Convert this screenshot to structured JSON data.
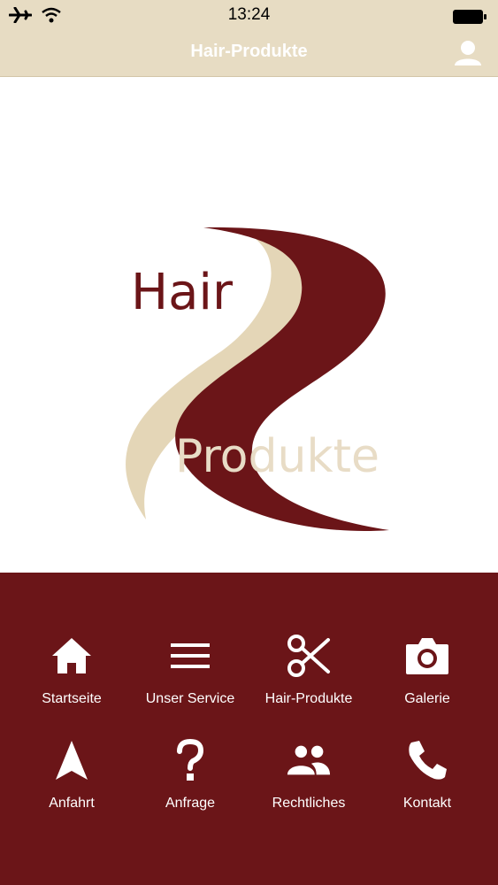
{
  "status_bar": {
    "time": "13:24",
    "icons": [
      "airplane-icon",
      "wifi-icon",
      "battery-icon"
    ]
  },
  "nav_bar": {
    "title": "Hair-Produkte",
    "right_icon": "user-icon"
  },
  "logo": {
    "word_top": "Hair",
    "word_bottom": "Produkte",
    "colors": {
      "wave_dark": "#6b1518",
      "wave_light": "#e4d6b7",
      "text": "#6b1518",
      "text_on_dark": "#e8dcc6"
    }
  },
  "colors": {
    "bar_bg": "#e7dcc3",
    "menu_bg": "#6b1518",
    "menu_text": "#ffffff"
  },
  "menu": {
    "items": [
      {
        "label": "Startseite",
        "icon": "home-icon"
      },
      {
        "label": "Unser Service",
        "icon": "menu-lines-icon"
      },
      {
        "label": "Hair-Produkte",
        "icon": "scissors-icon"
      },
      {
        "label": "Galerie",
        "icon": "camera-icon"
      },
      {
        "label": "Anfahrt",
        "icon": "navigation-arrow-icon"
      },
      {
        "label": "Anfrage",
        "icon": "question-mark-icon"
      },
      {
        "label": "Rechtliches",
        "icon": "people-icon"
      },
      {
        "label": "Kontakt",
        "icon": "phone-icon"
      }
    ]
  }
}
